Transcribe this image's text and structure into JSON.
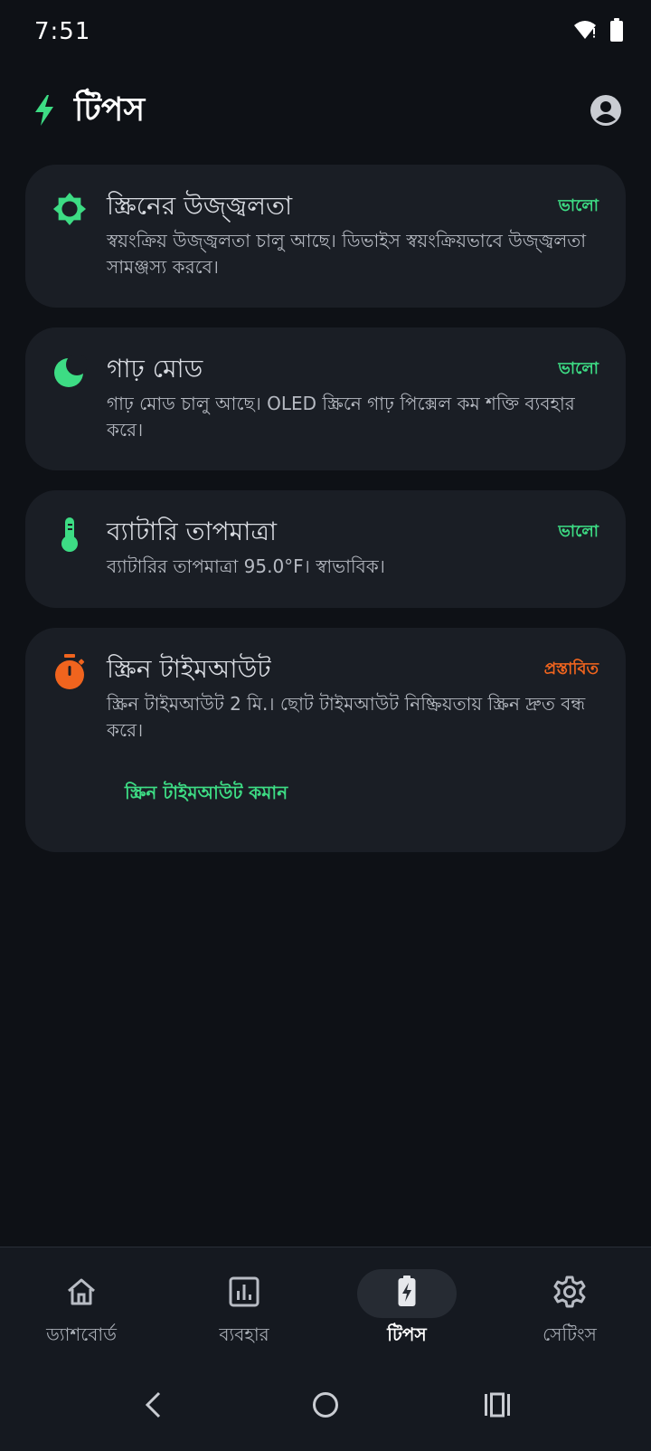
{
  "status_bar": {
    "time": "7:51"
  },
  "header": {
    "title": "টিপস"
  },
  "colors": {
    "accent": "#3ddc84",
    "warning": "#f0641e",
    "card_bg": "#1a1e25",
    "page_bg": "#0e1116"
  },
  "cards": [
    {
      "icon": "brightness-icon",
      "title": "স্ক্রিনের উজ্জ্বলতা",
      "status": "ভালো",
      "description": "স্বয়ংক্রিয় উজ্জ্বলতা চালু আছে। ডিভাইস স্বয়ংক্রিয়ভাবে উজ্জ্বলতা সামঞ্জস্য করবে।"
    },
    {
      "icon": "moon-icon",
      "title": "গাঢ় মোড",
      "status": "ভালো",
      "description": "গাঢ় মোড চালু আছে। OLED স্ক্রিনে গাঢ় পিক্সেল কম শক্তি ব্যবহার করে।"
    },
    {
      "icon": "thermometer-icon",
      "title": "ব্যাটারি তাপমাত্রা",
      "status": "ভালো",
      "description": "ব্যাটারির তাপমাত্রা 95.0°F। স্বাভাবিক।"
    },
    {
      "icon": "timer-icon",
      "title": "স্ক্রিন টাইমআউট",
      "status": "প্রস্তাবিত",
      "description": "স্ক্রিন টাইমআউট 2 মি.। ছোট টাইমআউট নিষ্ক্রিয়তায় স্ক্রিন দ্রুত বন্ধ করে।",
      "action": "স্ক্রিন টাইমআউট কমান"
    }
  ],
  "bottom_nav": [
    {
      "icon": "home-icon",
      "label": "ড্যাশবোর্ড"
    },
    {
      "icon": "bar-chart-icon",
      "label": "ব্যবহার"
    },
    {
      "icon": "bolt-icon",
      "label": "টিপস",
      "active": true
    },
    {
      "icon": "gear-icon",
      "label": "সেটিংস"
    }
  ]
}
